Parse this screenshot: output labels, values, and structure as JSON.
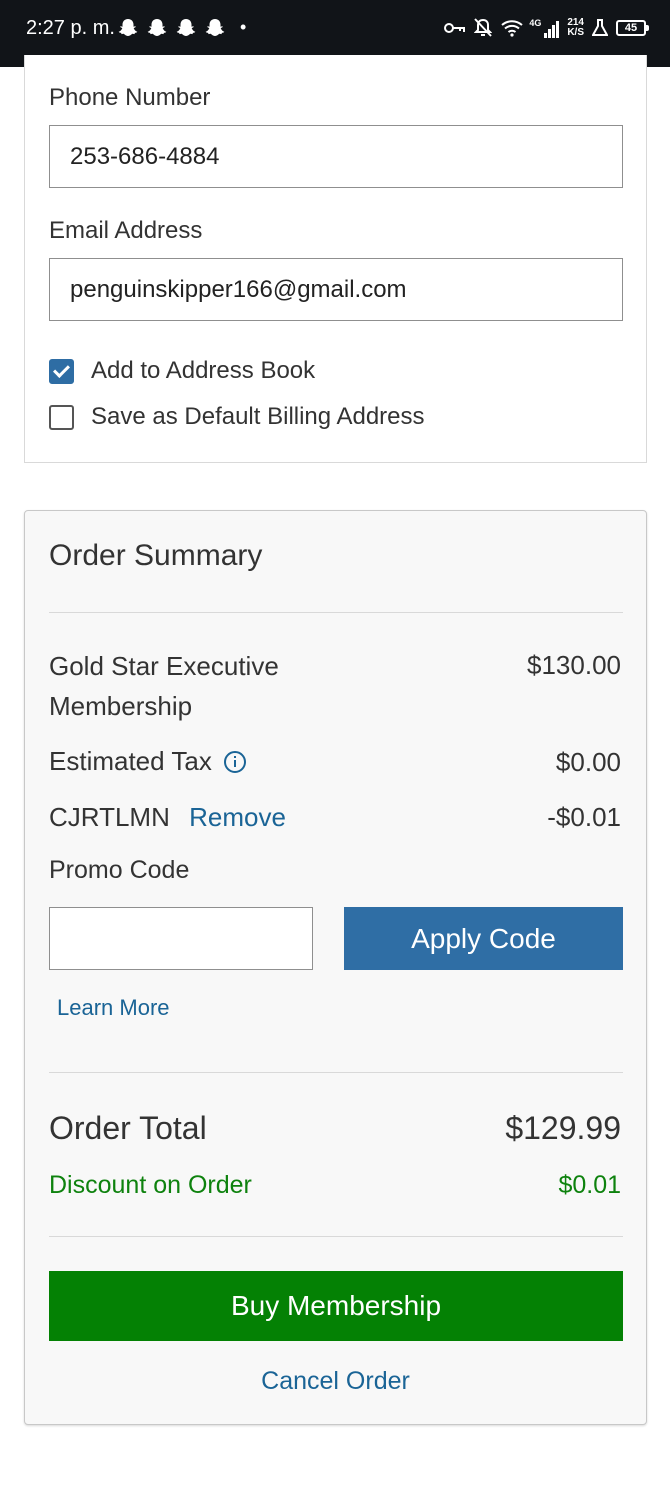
{
  "status_bar": {
    "time": "2:27 p. m.",
    "notification_icons": [
      "snapchat-icon",
      "snapchat-icon",
      "snapchat-icon",
      "snapchat-icon"
    ],
    "more_dot": "•",
    "network_label": "4G",
    "data_speed_top": "214",
    "data_speed_bottom": "K/S",
    "battery_level": "45"
  },
  "contact": {
    "phone_label": "Phone Number",
    "phone_value": "253-686-4884",
    "email_label": "Email Address",
    "email_value": "penguinskipper166@gmail.com",
    "add_to_address_book": {
      "label": "Add to Address Book",
      "checked": true
    },
    "save_default_billing": {
      "label": "Save as Default Billing Address",
      "checked": false
    }
  },
  "order_summary": {
    "title": "Order Summary",
    "item_name": "Gold Star Executive Membership",
    "item_price": "$130.00",
    "tax_label": "Estimated Tax",
    "tax_value": "$0.00",
    "promo_applied_code": "CJRTLMN",
    "remove_label": "Remove",
    "promo_discount": "-$0.01",
    "promo_label": "Promo Code",
    "promo_input_value": "",
    "apply_label": "Apply Code",
    "learn_more_label": "Learn More",
    "total_label": "Order Total",
    "total_value": "$129.99",
    "discount_label": "Discount on Order",
    "discount_value": "$0.01",
    "buy_label": "Buy Membership",
    "cancel_label": "Cancel Order"
  },
  "colors": {
    "primary_blue": "#2f6ea5",
    "link_blue": "#1a6496",
    "buy_green": "#048104",
    "discount_green": "#0e820e"
  }
}
